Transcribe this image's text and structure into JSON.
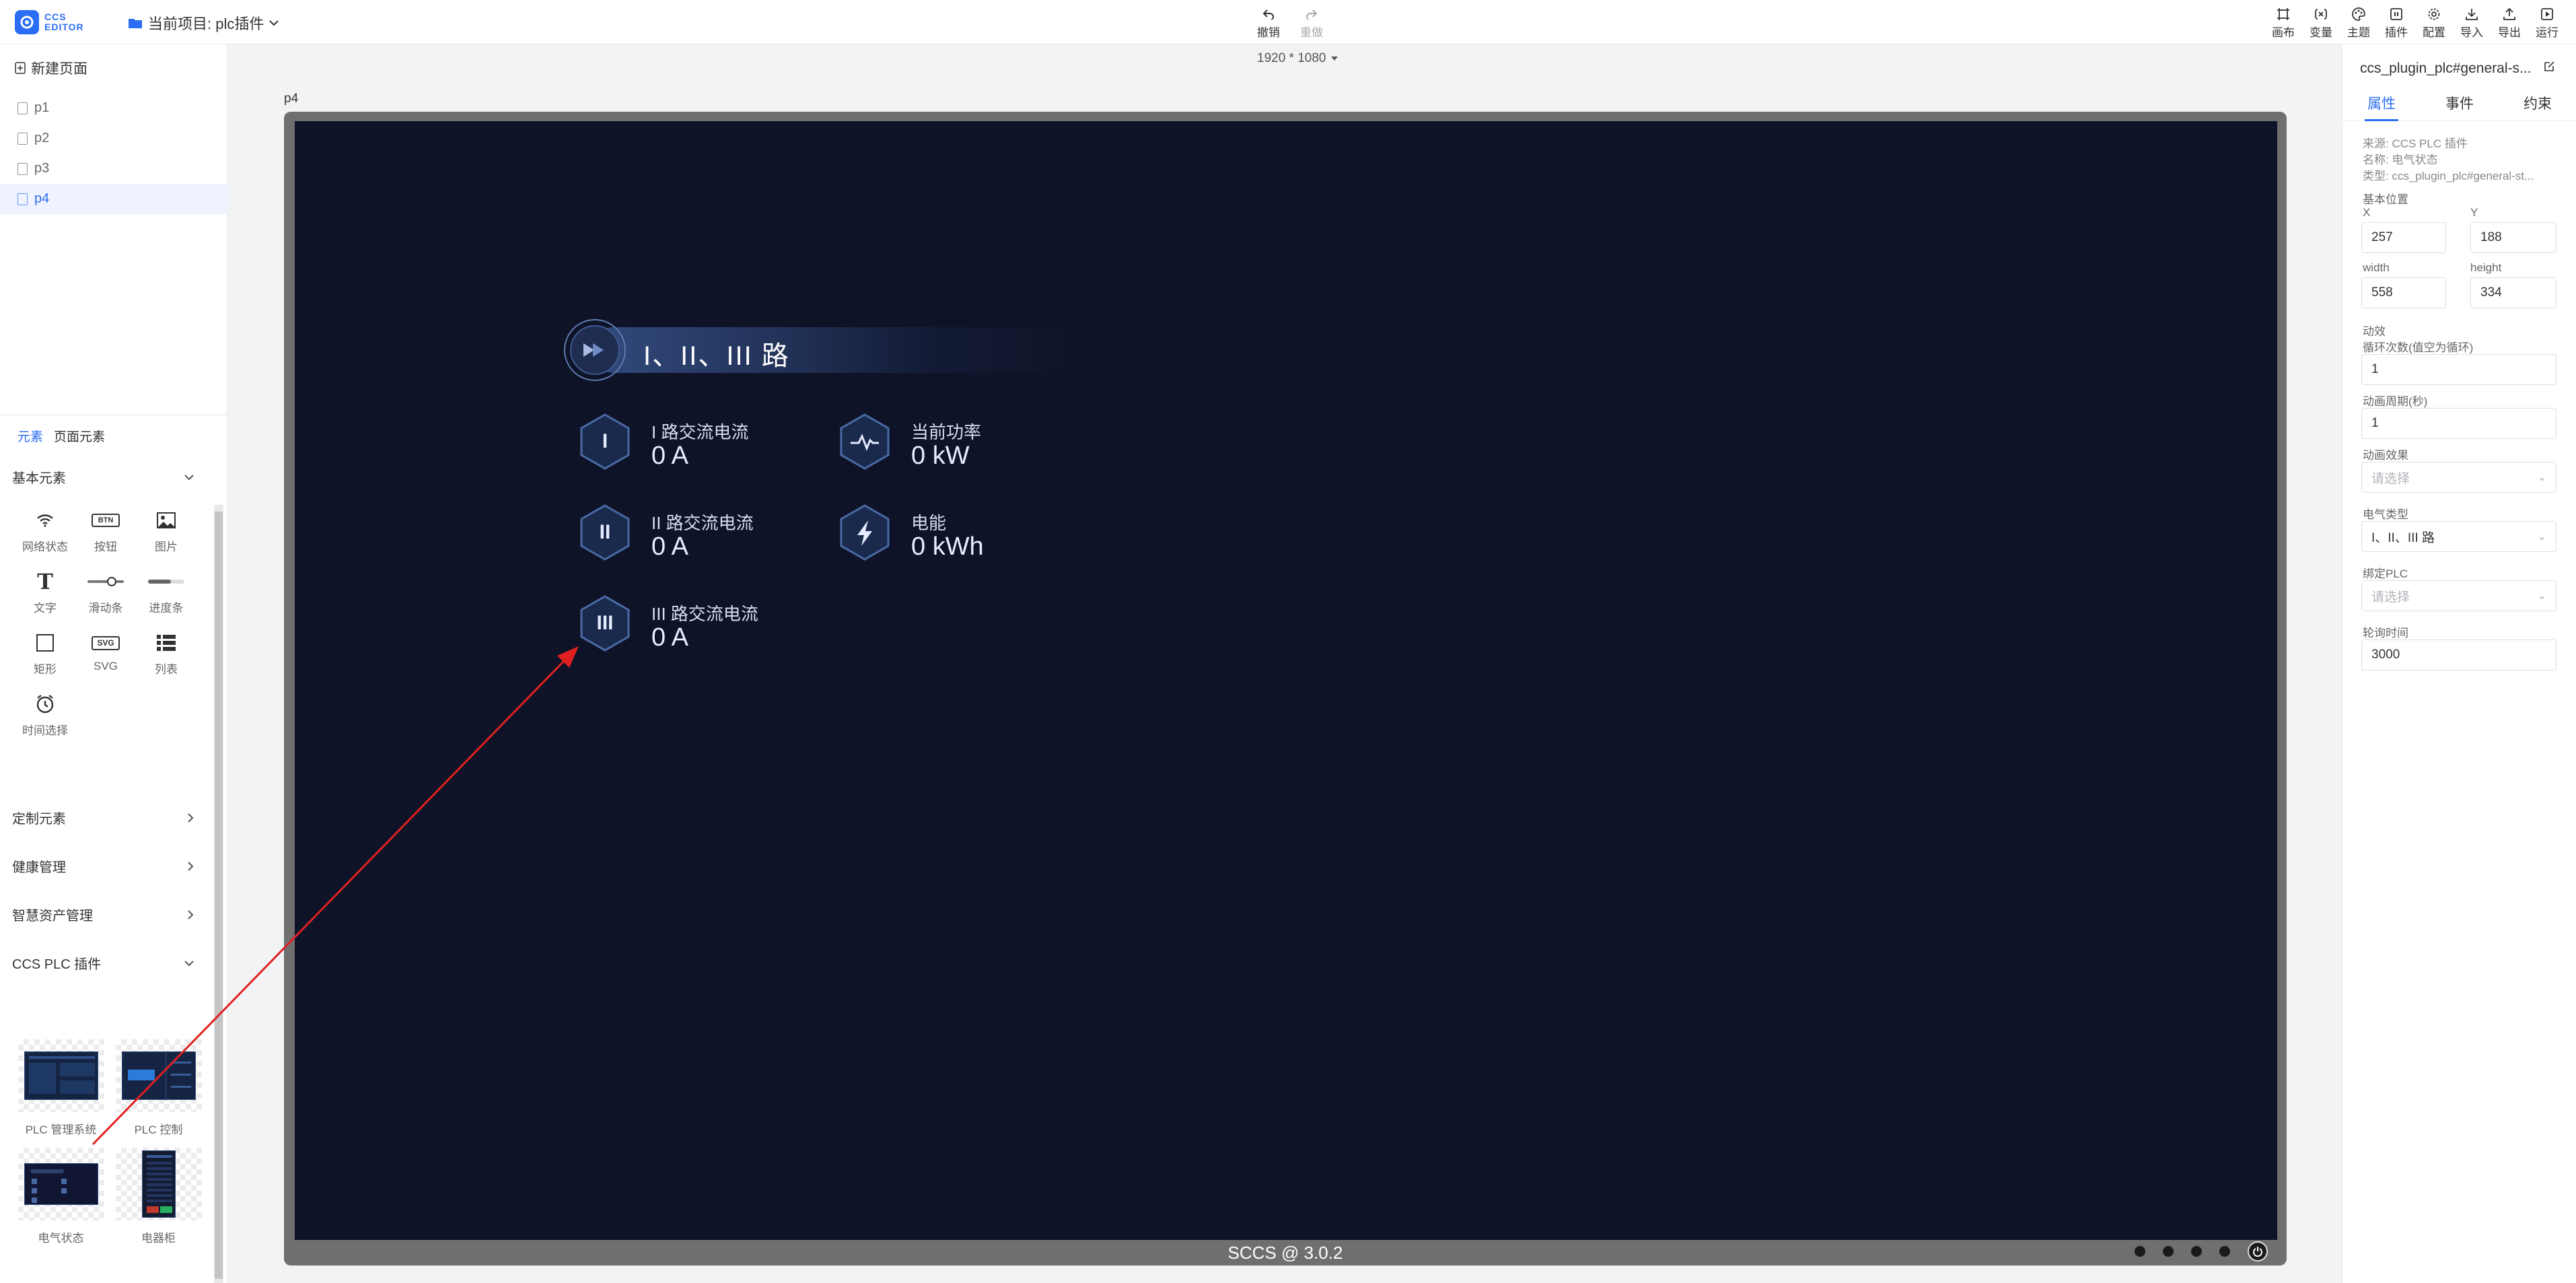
{
  "app": {
    "logo_top": "CCS",
    "logo_bottom": "EDITOR",
    "project_label": "当前项目: plc插件"
  },
  "toolbar": {
    "undo": "撤销",
    "redo": "重做",
    "right": [
      "画布",
      "变量",
      "主题",
      "插件",
      "配置",
      "导入",
      "导出",
      "运行"
    ]
  },
  "pages": {
    "new_page": "新建页面",
    "items": [
      "p1",
      "p2",
      "p3",
      "p4"
    ],
    "active": "p4"
  },
  "elements_panel": {
    "tab_elements": "元素",
    "tab_page_elements": "页面元素",
    "basic_section": "基本元素",
    "basic_items": [
      "网络状态",
      "按钮",
      "图片",
      "文字",
      "滑动条",
      "进度条",
      "矩形",
      "SVG",
      "列表",
      "时间选择"
    ],
    "btn_icon_text": "BTN",
    "svg_icon_text": "SVG",
    "custom_section": "定制元素",
    "health_section": "健康管理",
    "asset_section": "智慧资产管理",
    "plc_section": "CCS PLC 插件",
    "plc_items": [
      "PLC 管理系统",
      "PLC 控制",
      "电气状态",
      "电器柜"
    ]
  },
  "canvas": {
    "resolution": "1920 * 1080",
    "page_name": "p4",
    "footer": "SCCS @ 3.0.2"
  },
  "dashboard": {
    "title": "I、II、III 路",
    "metrics": [
      {
        "glyph": "I",
        "label": "I 路交流电流",
        "value": "0 A"
      },
      {
        "glyph": "II",
        "label": "II 路交流电流",
        "value": "0 A"
      },
      {
        "glyph": "III",
        "label": "III 路交流电流",
        "value": "0 A"
      },
      {
        "glyph": "pulse",
        "label": "当前功率",
        "value": "0 kW"
      },
      {
        "glyph": "bolt",
        "label": "电能",
        "value": "0 kWh"
      }
    ]
  },
  "properties": {
    "component_title": "ccs_plugin_plc#general-s...",
    "tabs": [
      "属性",
      "事件",
      "约束"
    ],
    "source": "来源: CCS PLC 插件",
    "name": "名称: 电气状态",
    "type": "类型: ccs_plugin_plc#general-st...",
    "position_label": "基本位置",
    "x_label": "X",
    "x_value": "257",
    "y_label": "Y",
    "y_value": "188",
    "width_label": "width",
    "width_value": "558",
    "height_label": "height",
    "height_value": "334",
    "anim_label": "动效",
    "loop_label": "循环次数(值空为循环)",
    "loop_value": "1",
    "period_label": "动画周期(秒)",
    "period_value": "1",
    "effect_label": "动画效果",
    "effect_placeholder": "请选择",
    "electric_type_label": "电气类型",
    "electric_type_value": "I、II、III 路",
    "bind_plc_label": "绑定PLC",
    "bind_plc_placeholder": "请选择",
    "poll_label": "轮询时间",
    "poll_value": "3000"
  },
  "colors": {
    "accent": "#2b6ef5",
    "screen_bg": "#0f1327",
    "annotation_arrow": "#e02020"
  }
}
